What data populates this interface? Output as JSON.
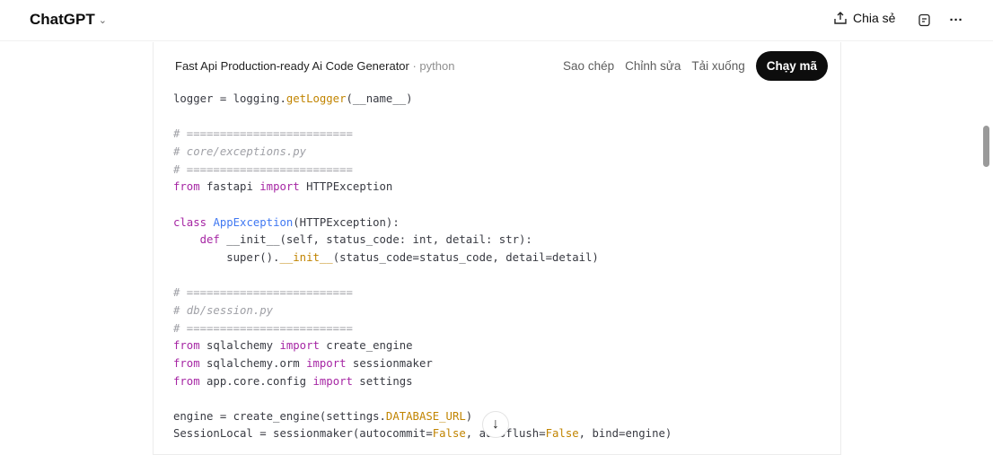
{
  "header": {
    "brand": "ChatGPT",
    "share_label": "Chia sẻ"
  },
  "codeblock": {
    "title": "Fast Api Production-ready Ai Code Generator",
    "lang": " · python",
    "copy": "Sao chép",
    "edit": "Chỉnh sửa",
    "download": "Tải xuống",
    "run": "Chạy mã",
    "lines": [
      [
        [
          "",
          "logger = logging."
        ],
        [
          "lit",
          "getLogger"
        ],
        [
          "",
          "(__name__)"
        ]
      ],
      [],
      [
        [
          "cm",
          "# ========================="
        ]
      ],
      [
        [
          "cm",
          "# core/exceptions.py"
        ]
      ],
      [
        [
          "cm",
          "# ========================="
        ]
      ],
      [
        [
          "kw",
          "from"
        ],
        [
          "",
          " fastapi "
        ],
        [
          "kw",
          "import"
        ],
        [
          "",
          " HTTPException"
        ]
      ],
      [],
      [
        [
          "kw",
          "class"
        ],
        [
          "",
          " "
        ],
        [
          "fn",
          "AppException"
        ],
        [
          "",
          "(HTTPException):"
        ]
      ],
      [
        [
          "",
          "    "
        ],
        [
          "kw",
          "def"
        ],
        [
          "",
          " __init__(self, status_code: int, detail: str):"
        ]
      ],
      [
        [
          "",
          "        super()."
        ],
        [
          "lit",
          "__init__"
        ],
        [
          "",
          "(status_code=status_code, detail=detail)"
        ]
      ],
      [],
      [
        [
          "cm",
          "# ========================="
        ]
      ],
      [
        [
          "cm",
          "# db/session.py"
        ]
      ],
      [
        [
          "cm",
          "# ========================="
        ]
      ],
      [
        [
          "kw",
          "from"
        ],
        [
          "",
          " sqlalchemy "
        ],
        [
          "kw",
          "import"
        ],
        [
          "",
          " create_engine"
        ]
      ],
      [
        [
          "kw",
          "from"
        ],
        [
          "",
          " sqlalchemy.orm "
        ],
        [
          "kw",
          "import"
        ],
        [
          "",
          " sessionmaker"
        ]
      ],
      [
        [
          "kw",
          "from"
        ],
        [
          "",
          " app.core.config "
        ],
        [
          "kw",
          "import"
        ],
        [
          "",
          " settings"
        ]
      ],
      [],
      [
        [
          "",
          "engine = create_engine(settings."
        ],
        [
          "lit",
          "DATABASE_URL"
        ],
        [
          "",
          ")"
        ]
      ],
      [
        [
          "",
          "SessionLocal = sessionmaker(autocommit="
        ],
        [
          "lit",
          "False"
        ],
        [
          "",
          ", autoflush="
        ],
        [
          "lit",
          "False"
        ],
        [
          "",
          ", bind=engine)"
        ]
      ]
    ]
  }
}
